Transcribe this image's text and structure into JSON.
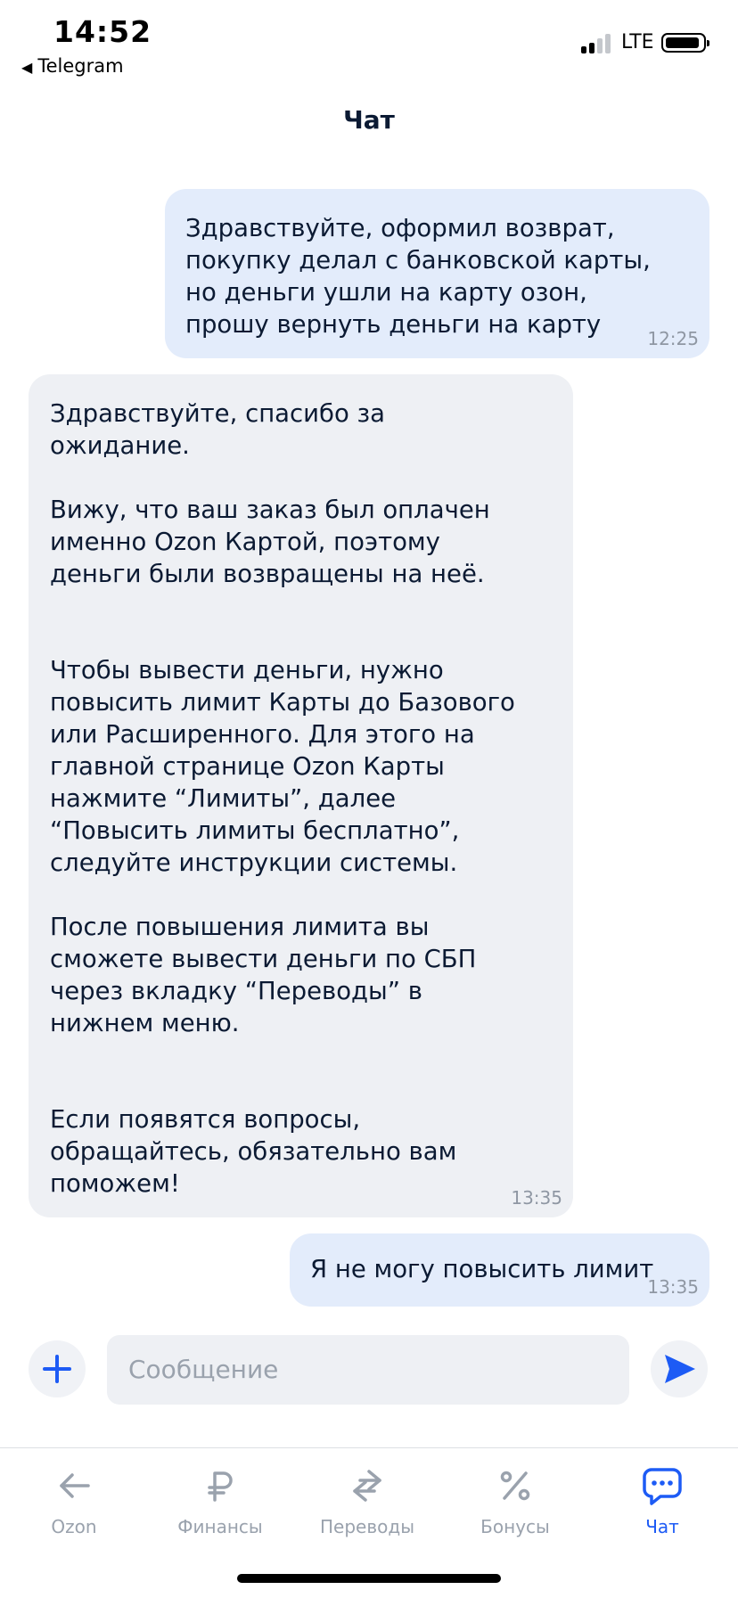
{
  "status_bar": {
    "time": "14:52",
    "back_app": "Telegram",
    "network": "LTE"
  },
  "header": {
    "title": "Чат"
  },
  "messages": [
    {
      "direction": "out",
      "text": "Здравствуйте, оформил возврат,\nпокупку делал с банковской карты,\nно деньги ушли на карту озон,\nпрошу вернуть деньги на карту",
      "time": "12:25"
    },
    {
      "direction": "in",
      "text": "Здравствуйте, спасибо за\nожидание.\n\nВижу, что ваш заказ был оплачен\nименно Ozon Картой, поэтому\nденьги были возвращены на неё.\n\n\nЧтобы вывести деньги, нужно\nповысить лимит Карты до Базового\nили Расширенного. Для этого на\nглавной странице Ozon Карты\nнажмите “Лимиты”, далее\n“Повысить лимиты бесплатно”,\nследуйте инструкции системы.\n\nПосле повышения лимита вы\nсможете вывести деньги по СБП\nчерез вкладку “Переводы” в\nнижнем меню.\n\n\nЕсли появятся вопросы,\nобращайтесь, обязательно вам\nпоможем!",
      "time": "13:35"
    },
    {
      "direction": "out",
      "text": "Я не могу повысить лимит",
      "time": "13:35"
    }
  ],
  "composer": {
    "placeholder": "Сообщение",
    "value": "",
    "plus_icon": "plus-icon",
    "send_icon": "send-icon"
  },
  "tabbar": {
    "items": [
      {
        "label": "Ozon",
        "icon": "arrow-left-icon",
        "active": false
      },
      {
        "label": "Финансы",
        "icon": "ruble-icon",
        "active": false
      },
      {
        "label": "Переводы",
        "icon": "transfer-arrows-icon",
        "active": false
      },
      {
        "label": "Бонусы",
        "icon": "percent-icon",
        "active": false
      },
      {
        "label": "Чат",
        "icon": "chat-bubble-icon",
        "active": true
      }
    ]
  },
  "colors": {
    "accent": "#1d5bf5",
    "outgoing_bubble": "#e3ecfb",
    "incoming_bubble": "#eef0f4",
    "inactive_tab": "#9aa2ad"
  }
}
